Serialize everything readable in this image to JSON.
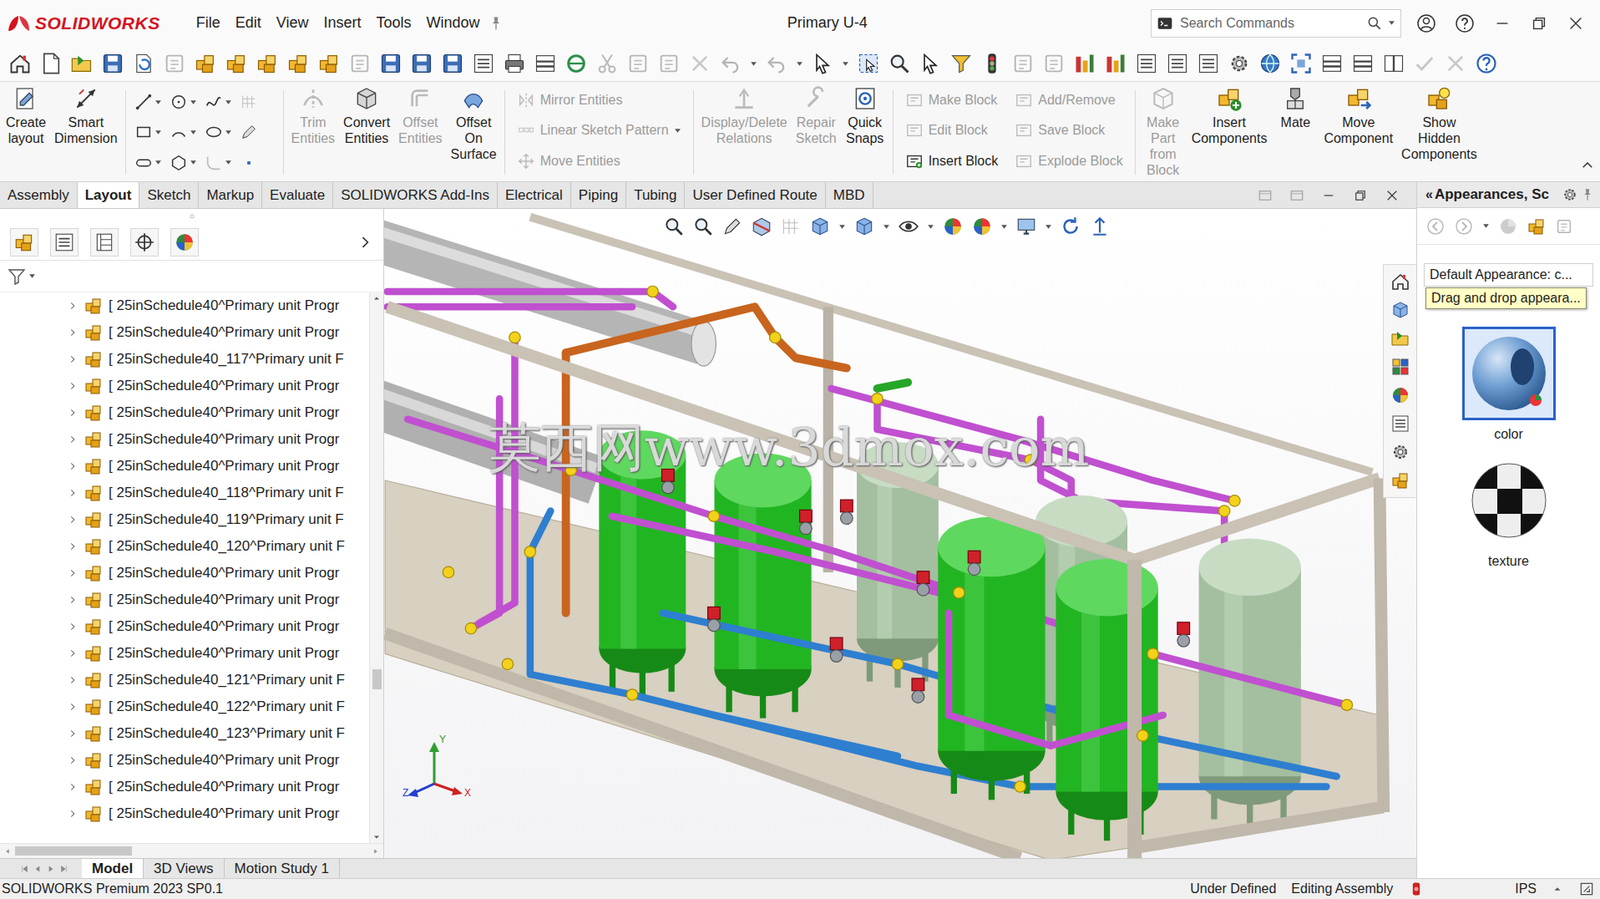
{
  "window": {
    "app": "SOLIDWORKS",
    "title": "Primary U-4",
    "menus": [
      "File",
      "Edit",
      "View",
      "Insert",
      "Tools",
      "Window"
    ]
  },
  "search": {
    "placeholder": "Search Commands"
  },
  "ribbon": [
    {
      "kind": "large",
      "label": "Create layout",
      "disabled": false
    },
    {
      "kind": "large",
      "label": "Smart Dimension",
      "disabled": false
    },
    {
      "kind": "grid"
    },
    {
      "kind": "large",
      "label": "Trim Entities",
      "disabled": true
    },
    {
      "kind": "large",
      "label": "Convert Entities",
      "disabled": false
    },
    {
      "kind": "large",
      "label": "Offset Entities",
      "disabled": true
    },
    {
      "kind": "large",
      "label": "Offset On Surface",
      "disabled": false
    },
    {
      "kind": "stack",
      "items": [
        {
          "label": "Mirror Entities",
          "disabled": true
        },
        {
          "label": "Linear Sketch Pattern",
          "disabled": true
        },
        {
          "label": "Move Entities",
          "disabled": true
        }
      ]
    },
    {
      "kind": "large",
      "label": "Display/Delete Relations",
      "disabled": true
    },
    {
      "kind": "large",
      "label": "Repair Sketch",
      "disabled": true
    },
    {
      "kind": "large",
      "label": "Quick Snaps",
      "disabled": false
    },
    {
      "kind": "stack",
      "items": [
        {
          "label": "Make Block",
          "disabled": true
        },
        {
          "label": "Edit Block",
          "disabled": true
        },
        {
          "label": "Insert Block",
          "disabled": false
        }
      ]
    },
    {
      "kind": "stack",
      "items": [
        {
          "label": "Add/Remove",
          "disabled": true
        },
        {
          "label": "Save Block",
          "disabled": true
        },
        {
          "label": "Explode Block",
          "disabled": true
        }
      ]
    },
    {
      "kind": "large",
      "label": "Make Part from Block",
      "disabled": true
    },
    {
      "kind": "large",
      "label": "Insert Components",
      "disabled": false
    },
    {
      "kind": "large",
      "label": "Mate",
      "disabled": false
    },
    {
      "kind": "large",
      "label": "Move Component",
      "disabled": false
    },
    {
      "kind": "large",
      "label": "Show Hidden Components",
      "disabled": false
    }
  ],
  "command_tabs": [
    {
      "label": "Assembly",
      "selected": false
    },
    {
      "label": "Layout",
      "selected": true
    },
    {
      "label": "Sketch",
      "selected": false
    },
    {
      "label": "Markup",
      "selected": false
    },
    {
      "label": "Evaluate",
      "selected": false
    },
    {
      "label": "SOLIDWORKS Add-Ins",
      "selected": false
    },
    {
      "label": "Electrical",
      "selected": false
    },
    {
      "label": "Piping",
      "selected": false
    },
    {
      "label": "Tubing",
      "selected": false
    },
    {
      "label": "User Defined Route",
      "selected": false
    },
    {
      "label": "MBD",
      "selected": false
    }
  ],
  "feature_tree": {
    "items": [
      {
        "label": "[ 25inSchedule40^Primary unit Progr",
        "expanded": false
      },
      {
        "label": "[ 25inSchedule40^Primary unit Progr",
        "expanded": false
      },
      {
        "label": "[ 25inSchedule40_117^Primary unit F",
        "expanded": false
      },
      {
        "label": "[ 25inSchedule40^Primary unit Progr",
        "expanded": false
      },
      {
        "label": "[ 25inSchedule40^Primary unit Progr",
        "expanded": false
      },
      {
        "label": "[ 25inSchedule40^Primary unit Progr",
        "expanded": false
      },
      {
        "label": "[ 25inSchedule40^Primary unit Progr",
        "expanded": false
      },
      {
        "label": "[ 25inSchedule40_118^Primary unit F",
        "expanded": false
      },
      {
        "label": "[ 25inSchedule40_119^Primary unit F",
        "expanded": false
      },
      {
        "label": "[ 25inSchedule40_120^Primary unit F",
        "expanded": false
      },
      {
        "label": "[ 25inSchedule40^Primary unit Progr",
        "expanded": false
      },
      {
        "label": "[ 25inSchedule40^Primary unit Progr",
        "expanded": false
      },
      {
        "label": "[ 25inSchedule40^Primary unit Progr",
        "expanded": false
      },
      {
        "label": "[ 25inSchedule40^Primary unit Progr",
        "expanded": false
      },
      {
        "label": "[ 25inSchedule40_121^Primary unit F",
        "expanded": false
      },
      {
        "label": "[ 25inSchedule40_122^Primary unit F",
        "expanded": false
      },
      {
        "label": "[ 25inSchedule40_123^Primary unit F",
        "expanded": false
      },
      {
        "label": "[ 25inSchedule40^Primary unit Progr",
        "expanded": false
      },
      {
        "label": "[ 25inSchedule40^Primary unit Progr",
        "expanded": false
      },
      {
        "label": "[ 25inSchedule40^Primary unit Progr",
        "expanded": false
      }
    ]
  },
  "viewport": {
    "watermark": "莫西网www.3dmox.com",
    "triad": {
      "y": "Y",
      "z": "Z",
      "x": "X"
    }
  },
  "task_pane": {
    "collapse": "«",
    "title": "Appearances, Sc",
    "items": [
      {
        "label": "Default Appearance: c...",
        "selected": false
      }
    ],
    "tooltip": "Drag and drop appeara...",
    "swatches": [
      {
        "label": "color",
        "selected": true
      },
      {
        "label": "texture",
        "selected": false
      }
    ]
  },
  "document_tabs": [
    {
      "label": "Model",
      "selected": true
    },
    {
      "label": "3D Views",
      "selected": false
    },
    {
      "label": "Motion Study 1",
      "selected": false
    }
  ],
  "status_bar": {
    "product": "SOLIDWORKS Premium 2023 SP0.1",
    "sketch_state": "Under Defined",
    "mode": "Editing Assembly",
    "units": "IPS"
  }
}
